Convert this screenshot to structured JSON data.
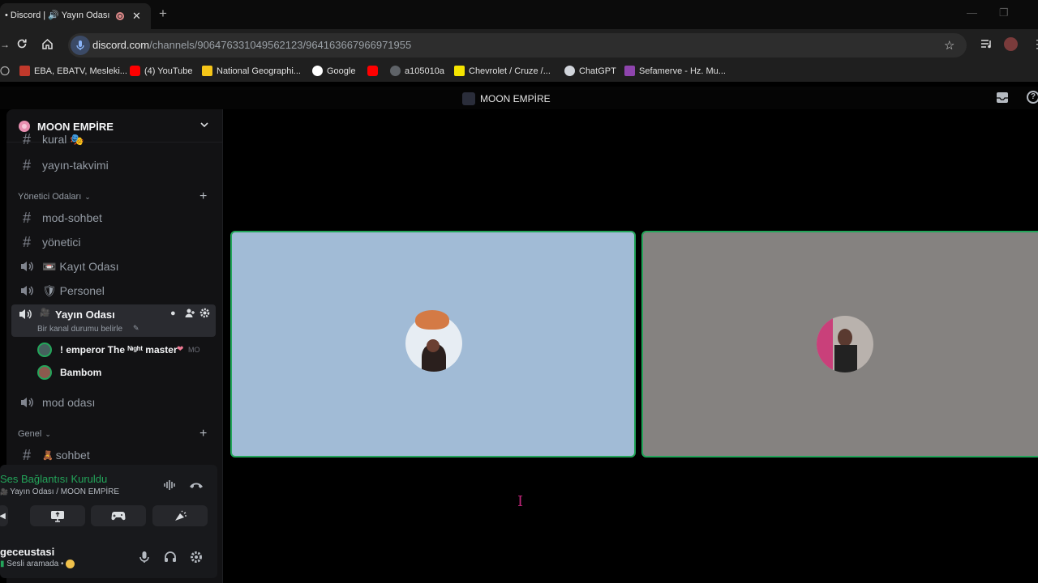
{
  "browser": {
    "tab_title": "• Discord | 🔊 Yayın Odası",
    "url_host": "discord.com",
    "url_path": "/channels/906476331049562123/964163667966971955",
    "bookmarks": [
      {
        "label": "EBA, EBATV, Mesleki...",
        "color": "#c0392b"
      },
      {
        "label": "(4) YouTube",
        "color": "#ff0000"
      },
      {
        "label": "National Geographi...",
        "color": "#f5c518"
      },
      {
        "label": "Google",
        "color": "#ffffff"
      },
      {
        "label": "",
        "color": "#ff0000"
      },
      {
        "label": "a105010a",
        "color": "#9aa0a6"
      },
      {
        "label": "Chevrolet / Cruze /...",
        "color": "#f5e400"
      },
      {
        "label": "ChatGPT",
        "color": "#d1d5db"
      },
      {
        "label": "Sefamerve - Hz. Mu...",
        "color": "#8e44ad"
      }
    ]
  },
  "discord": {
    "server_name": "MOON EMPİRE",
    "channels_top": [
      {
        "name": "kural 🎭",
        "icon": "hash"
      },
      {
        "name": "yayın-takvimi",
        "icon": "hash"
      }
    ],
    "category_admin": "Yönetici Odaları",
    "admin_channels": [
      {
        "name": "mod-sohbet",
        "icon": "hash"
      },
      {
        "name": "yönetici",
        "icon": "hash"
      },
      {
        "name": "📼 Kayıt Odası",
        "icon": "voice"
      },
      {
        "name": "🛡 Personel",
        "icon": "voice"
      }
    ],
    "active_channel": {
      "name": "Yayın Odası",
      "status": "Bir kanal durumu belirle"
    },
    "voice_members": [
      {
        "name": "! emperor The ᴺᶦᵍʰᵗ master",
        "extra": "MO"
      },
      {
        "name": "Bambom",
        "extra": ""
      }
    ],
    "mod_room": "mod odası",
    "category_general": "Genel",
    "general_channel": "sohbet",
    "voice_connected": "Ses Bağlantısı Kuruldu",
    "voice_location": "Yayın Odası / MOON EMPİRE",
    "username": "geceustasi",
    "user_status": "Sesli aramada •",
    "accent_green": "#23a55a"
  }
}
